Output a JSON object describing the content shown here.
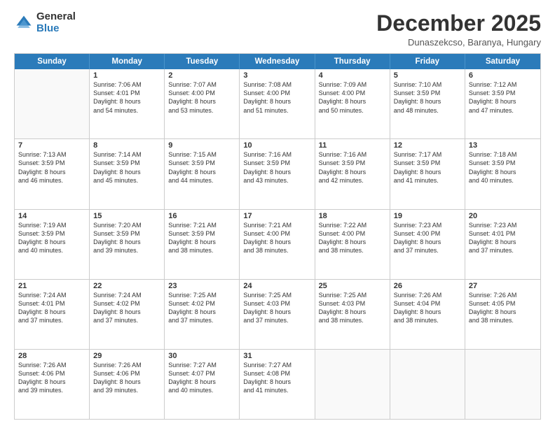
{
  "logo": {
    "general": "General",
    "blue": "Blue"
  },
  "header": {
    "title": "December 2025",
    "subtitle": "Dunaszekcso, Baranya, Hungary"
  },
  "weekdays": [
    "Sunday",
    "Monday",
    "Tuesday",
    "Wednesday",
    "Thursday",
    "Friday",
    "Saturday"
  ],
  "rows": [
    [
      {
        "day": "",
        "lines": []
      },
      {
        "day": "1",
        "lines": [
          "Sunrise: 7:06 AM",
          "Sunset: 4:01 PM",
          "Daylight: 8 hours",
          "and 54 minutes."
        ]
      },
      {
        "day": "2",
        "lines": [
          "Sunrise: 7:07 AM",
          "Sunset: 4:00 PM",
          "Daylight: 8 hours",
          "and 53 minutes."
        ]
      },
      {
        "day": "3",
        "lines": [
          "Sunrise: 7:08 AM",
          "Sunset: 4:00 PM",
          "Daylight: 8 hours",
          "and 51 minutes."
        ]
      },
      {
        "day": "4",
        "lines": [
          "Sunrise: 7:09 AM",
          "Sunset: 4:00 PM",
          "Daylight: 8 hours",
          "and 50 minutes."
        ]
      },
      {
        "day": "5",
        "lines": [
          "Sunrise: 7:10 AM",
          "Sunset: 3:59 PM",
          "Daylight: 8 hours",
          "and 48 minutes."
        ]
      },
      {
        "day": "6",
        "lines": [
          "Sunrise: 7:12 AM",
          "Sunset: 3:59 PM",
          "Daylight: 8 hours",
          "and 47 minutes."
        ]
      }
    ],
    [
      {
        "day": "7",
        "lines": [
          "Sunrise: 7:13 AM",
          "Sunset: 3:59 PM",
          "Daylight: 8 hours",
          "and 46 minutes."
        ]
      },
      {
        "day": "8",
        "lines": [
          "Sunrise: 7:14 AM",
          "Sunset: 3:59 PM",
          "Daylight: 8 hours",
          "and 45 minutes."
        ]
      },
      {
        "day": "9",
        "lines": [
          "Sunrise: 7:15 AM",
          "Sunset: 3:59 PM",
          "Daylight: 8 hours",
          "and 44 minutes."
        ]
      },
      {
        "day": "10",
        "lines": [
          "Sunrise: 7:16 AM",
          "Sunset: 3:59 PM",
          "Daylight: 8 hours",
          "and 43 minutes."
        ]
      },
      {
        "day": "11",
        "lines": [
          "Sunrise: 7:16 AM",
          "Sunset: 3:59 PM",
          "Daylight: 8 hours",
          "and 42 minutes."
        ]
      },
      {
        "day": "12",
        "lines": [
          "Sunrise: 7:17 AM",
          "Sunset: 3:59 PM",
          "Daylight: 8 hours",
          "and 41 minutes."
        ]
      },
      {
        "day": "13",
        "lines": [
          "Sunrise: 7:18 AM",
          "Sunset: 3:59 PM",
          "Daylight: 8 hours",
          "and 40 minutes."
        ]
      }
    ],
    [
      {
        "day": "14",
        "lines": [
          "Sunrise: 7:19 AM",
          "Sunset: 3:59 PM",
          "Daylight: 8 hours",
          "and 40 minutes."
        ]
      },
      {
        "day": "15",
        "lines": [
          "Sunrise: 7:20 AM",
          "Sunset: 3:59 PM",
          "Daylight: 8 hours",
          "and 39 minutes."
        ]
      },
      {
        "day": "16",
        "lines": [
          "Sunrise: 7:21 AM",
          "Sunset: 3:59 PM",
          "Daylight: 8 hours",
          "and 38 minutes."
        ]
      },
      {
        "day": "17",
        "lines": [
          "Sunrise: 7:21 AM",
          "Sunset: 4:00 PM",
          "Daylight: 8 hours",
          "and 38 minutes."
        ]
      },
      {
        "day": "18",
        "lines": [
          "Sunrise: 7:22 AM",
          "Sunset: 4:00 PM",
          "Daylight: 8 hours",
          "and 38 minutes."
        ]
      },
      {
        "day": "19",
        "lines": [
          "Sunrise: 7:23 AM",
          "Sunset: 4:00 PM",
          "Daylight: 8 hours",
          "and 37 minutes."
        ]
      },
      {
        "day": "20",
        "lines": [
          "Sunrise: 7:23 AM",
          "Sunset: 4:01 PM",
          "Daylight: 8 hours",
          "and 37 minutes."
        ]
      }
    ],
    [
      {
        "day": "21",
        "lines": [
          "Sunrise: 7:24 AM",
          "Sunset: 4:01 PM",
          "Daylight: 8 hours",
          "and 37 minutes."
        ]
      },
      {
        "day": "22",
        "lines": [
          "Sunrise: 7:24 AM",
          "Sunset: 4:02 PM",
          "Daylight: 8 hours",
          "and 37 minutes."
        ]
      },
      {
        "day": "23",
        "lines": [
          "Sunrise: 7:25 AM",
          "Sunset: 4:02 PM",
          "Daylight: 8 hours",
          "and 37 minutes."
        ]
      },
      {
        "day": "24",
        "lines": [
          "Sunrise: 7:25 AM",
          "Sunset: 4:03 PM",
          "Daylight: 8 hours",
          "and 37 minutes."
        ]
      },
      {
        "day": "25",
        "lines": [
          "Sunrise: 7:25 AM",
          "Sunset: 4:03 PM",
          "Daylight: 8 hours",
          "and 38 minutes."
        ]
      },
      {
        "day": "26",
        "lines": [
          "Sunrise: 7:26 AM",
          "Sunset: 4:04 PM",
          "Daylight: 8 hours",
          "and 38 minutes."
        ]
      },
      {
        "day": "27",
        "lines": [
          "Sunrise: 7:26 AM",
          "Sunset: 4:05 PM",
          "Daylight: 8 hours",
          "and 38 minutes."
        ]
      }
    ],
    [
      {
        "day": "28",
        "lines": [
          "Sunrise: 7:26 AM",
          "Sunset: 4:06 PM",
          "Daylight: 8 hours",
          "and 39 minutes."
        ]
      },
      {
        "day": "29",
        "lines": [
          "Sunrise: 7:26 AM",
          "Sunset: 4:06 PM",
          "Daylight: 8 hours",
          "and 39 minutes."
        ]
      },
      {
        "day": "30",
        "lines": [
          "Sunrise: 7:27 AM",
          "Sunset: 4:07 PM",
          "Daylight: 8 hours",
          "and 40 minutes."
        ]
      },
      {
        "day": "31",
        "lines": [
          "Sunrise: 7:27 AM",
          "Sunset: 4:08 PM",
          "Daylight: 8 hours",
          "and 41 minutes."
        ]
      },
      {
        "day": "",
        "lines": []
      },
      {
        "day": "",
        "lines": []
      },
      {
        "day": "",
        "lines": []
      }
    ]
  ]
}
